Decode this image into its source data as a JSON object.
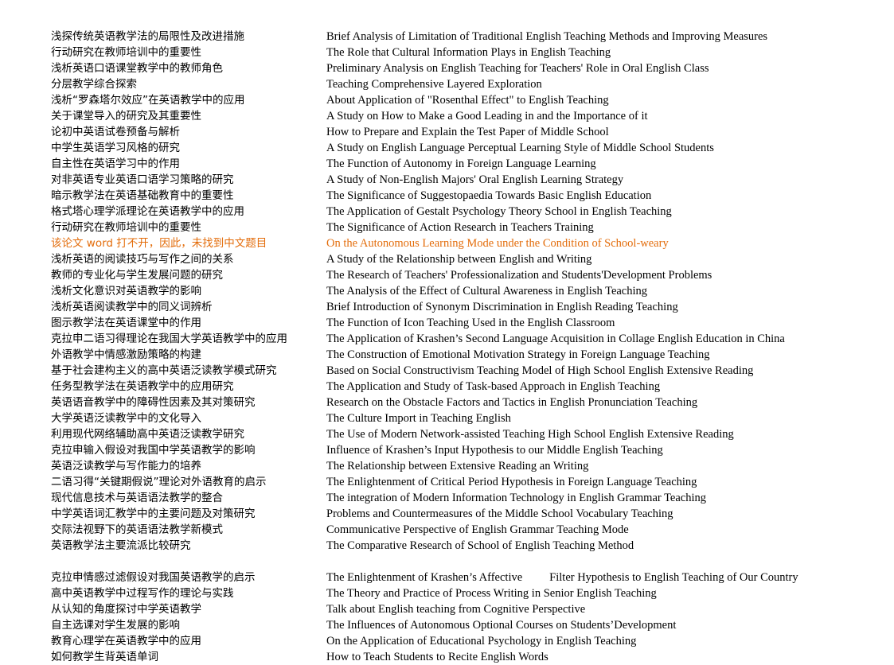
{
  "document": {
    "colors": {
      "text": "#000000",
      "highlight": "#e36c0a",
      "background": "#ffffff"
    },
    "note_cn": "该论文 word 打不开，因此，未找到中文题目",
    "note_en": "On the Autonomous Learning Mode under the Condition of School-weary"
  },
  "rows": [
    {
      "cn": "浅探传统英语教学法的局限性及改进措施",
      "en": "Brief Analysis of  Limitation of Traditional English Teaching Methods and Improving Measures",
      "highlight": false
    },
    {
      "cn": "行动研究在教师培训中的重要性",
      "en": "The Role that Cultural Information Plays in English Teaching",
      "highlight": false
    },
    {
      "cn": "浅析英语口语课堂教学中的教师角色",
      "en": "Preliminary Analysis on English Teaching for Teachers' Role in Oral English Class",
      "highlight": false
    },
    {
      "cn": "分层教学综合探索",
      "en": "Teaching Comprehensive Layered Exploration",
      "highlight": false
    },
    {
      "cn": "浅析“罗森塔尔效应”在英语教学中的应用",
      "en": "About Application of \"Rosenthal Effect\" to English Teaching",
      "highlight": false
    },
    {
      "cn": "关于课堂导入的研究及其重要性",
      "en": "A Study on How to Make a Good Leading in and the Importance of it",
      "highlight": false
    },
    {
      "cn": "论初中英语试卷预备与解析",
      "en": "How to Prepare and Explain the Test Paper of Middle School",
      "highlight": false
    },
    {
      "cn": "中学生英语学习风格的研究",
      "en": "A Study on English Language Perceptual Learning Style of Middle School Students",
      "highlight": false
    },
    {
      "cn": "自主性在英语学习中的作用",
      "en": "The Function of Autonomy in Foreign Language Learning",
      "highlight": false
    },
    {
      "cn": "对非英语专业英语口语学习策略的研究",
      "en": "A Study of Non-English Majors' Oral English Learning Strategy",
      "highlight": false
    },
    {
      "cn": "暗示教学法在英语基础教育中的重要性",
      "en": "The Significance of Suggestopaedia Towards Basic English Education",
      "highlight": false
    },
    {
      "cn": "格式塔心理学派理论在英语教学中的应用",
      "en": "The Application of Gestalt Psychology Theory School in English Teaching",
      "highlight": false
    },
    {
      "cn": "行动研究在教师培训中的重要性",
      "en": "The Significance of Action Research in Teachers Training",
      "highlight": false
    },
    {
      "cn": "该论文 word 打不开，因此，未找到中文题目",
      "en": "On the Autonomous Learning Mode under the Condition of School-weary",
      "highlight": true
    },
    {
      "cn": "浅析英语的阅读技巧与写作之间的关系",
      "en": "A Study of the Relationship between English and Writing",
      "highlight": false
    },
    {
      "cn": "教师的专业化与学生发展问题的研究",
      "en": "The Research of Teachers' Professionalization and Students'Development Problems",
      "highlight": false
    },
    {
      "cn": "浅析文化意识对英语教学的影响",
      "en": "The Analysis of the Effect of Cultural Awareness in English Teaching",
      "highlight": false
    },
    {
      "cn": "浅析英语阅读教学中的同义词辨析",
      "en": "Brief Introduction of Synonym Discrimination in English Reading Teaching",
      "highlight": false
    },
    {
      "cn": "图示教学法在英语课堂中的作用",
      "en": "The Function of Icon Teaching Used in the English Classroom",
      "highlight": false
    },
    {
      "cn": "克拉申二语习得理论在我国大学英语教学中的应用",
      "en": "The Application of Krashen’s Second Language Acquisition in Collage English Education in China",
      "highlight": false
    },
    {
      "cn": "外语教学中情感激励策略的构建",
      "en": "The Construction of Emotional Motivation Strategy in Foreign Language Teaching",
      "highlight": false
    },
    {
      "cn": "基于社会建构主义的高中英语泛读教学模式研究",
      "en": "Based on Social Constructivism Teaching Model of High School English Extensive Reading",
      "highlight": false
    },
    {
      "cn": "任务型教学法在英语教学中的应用研究",
      "en": "The Application and Study of Task-based Approach in English Teaching",
      "highlight": false
    },
    {
      "cn": "英语语音教学中的障碍性因素及其对策研究",
      "en": "Research on the Obstacle Factors and Tactics in English Pronunciation Teaching",
      "highlight": false
    },
    {
      "cn": "大学英语泛读教学中的文化导入",
      "en": "The Culture Import in Teaching English",
      "highlight": false
    },
    {
      "cn": "利用现代网络辅助高中英语泛读教学研究",
      "en": "The Use of Modern Network-assisted Teaching High School English Extensive Reading",
      "highlight": false
    },
    {
      "cn": "克拉申输入假设对我国中学英语教学的影响",
      "en": "Influence of Krashen’s Input Hypothesis to our Middle English Teaching",
      "highlight": false
    },
    {
      "cn": "英语泛读教学与写作能力的培养",
      "en": "The Relationship between Extensive Reading an Writing",
      "highlight": false
    },
    {
      "cn": "二语习得“关键期假说”理论对外语教育的启示",
      "en": "The Enlightenment of Critical Period Hypothesis in Foreign Language Teaching",
      "highlight": false
    },
    {
      "cn": "现代信息技术与英语语法教学的整合",
      "en": "The integration of Modern Information Technology in English Grammar Teaching",
      "highlight": false
    },
    {
      "cn": "中学英语词汇教学中的主要问题及对策研究",
      "en": "Problems and Countermeasures of the Middle School Vocabulary Teaching",
      "highlight": false
    },
    {
      "cn": "交际法视野下的英语语法教学新模式",
      "en": "Communicative Perspective of English Grammar Teaching Mode",
      "highlight": false
    },
    {
      "cn": "英语教学法主要流派比较研究",
      "en": "The Comparative Research of School of English Teaching Method",
      "highlight": false
    },
    {
      "spacer": true,
      "cn": "",
      "en": "",
      "highlight": false
    },
    {
      "cn": "克拉申情感过滤假设对我国英语教学的启示",
      "en_part1": "The Enlightenment of Krashen’s Affective",
      "en_part2": "Filter Hypothesis to English Teaching of Our Country",
      "en": "",
      "split": true,
      "highlight": false
    },
    {
      "cn": "高中英语教学中过程写作的理论与实践",
      "en": "The Theory and Practice of Process Writing in Senior English Teaching",
      "highlight": false
    },
    {
      "cn": "从认知的角度探讨中学英语教学",
      "en": "Talk about English teaching from Cognitive Perspective",
      "highlight": false
    },
    {
      "cn": "自主选课对学生发展的影响",
      "en": "The Influences of Autonomous Optional Courses on Students’Development",
      "highlight": false
    },
    {
      "cn": "教育心理学在英语教学中的应用",
      "en": "On the Application of Educational Psychology in English Teaching",
      "highlight": false
    },
    {
      "cn": "如何教学生背英语单词",
      "en": "How to Teach Students to Recite English Words",
      "highlight": false
    }
  ]
}
